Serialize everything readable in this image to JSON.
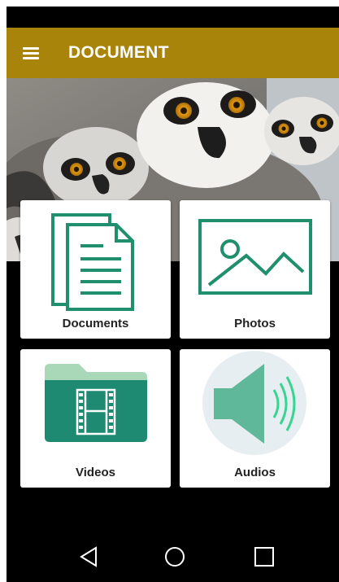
{
  "app_bar": {
    "title": "DOCUMENT",
    "background": "#a8850a",
    "menu_icon": "hamburger-menu-icon"
  },
  "hero": {
    "image": "ring-tailed lemurs photo"
  },
  "tiles": [
    {
      "label": "Documents",
      "icon": "documents-icon"
    },
    {
      "label": "Photos",
      "icon": "photo-icon"
    },
    {
      "label": "Videos",
      "icon": "video-folder-icon"
    },
    {
      "label": "Audios",
      "icon": "speaker-icon"
    }
  ],
  "nav_bar": {
    "buttons": [
      "back-icon",
      "home-icon",
      "recents-icon"
    ]
  },
  "colors": {
    "accent_green": "#1f8f6e",
    "light_green": "#a9d8b8",
    "folder_green": "#1f8a72"
  }
}
